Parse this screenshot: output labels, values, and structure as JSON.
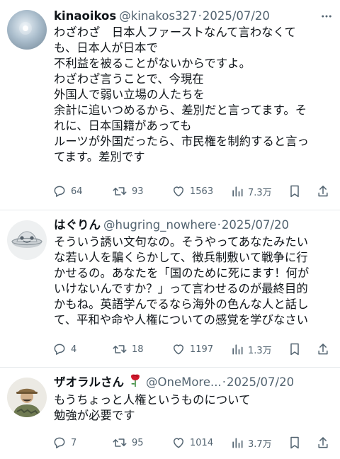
{
  "colors": {
    "text": "#0f1419",
    "muted": "#536471",
    "divider": "#e6e9ec"
  },
  "icons": [
    "more-icon",
    "reply-icon",
    "retweet-icon",
    "like-icon",
    "views-icon",
    "bookmark-icon",
    "share-icon",
    "rose-icon"
  ],
  "posts": [
    {
      "name": "kinaoikos",
      "handle": "@kinakos327",
      "dot": "·",
      "date": "2025/07/20",
      "lines": [
        "わざわざ　日本人ファーストなんて言わなくて",
        "も、日本人が日本で",
        "不利益を被ることがないからですよ。",
        "わざわざ言うことで、今現在",
        "外国人で弱い立場の人たちを",
        "余計に追いつめるから、差別だと言ってます。そ",
        "れに、日本国籍があっても",
        "ルーツが外国だったら、市民権を制約すると言っ",
        "てます。差別です"
      ],
      "replies": "64",
      "reposts": "93",
      "likes": "1563",
      "views": "7.3万"
    },
    {
      "name": "はぐりん",
      "handle": "@hugring_nowhere",
      "dot": "·",
      "date": "2025/07/20",
      "lines": [
        "そういう誘い文句なの。そうやってあなたみたい",
        "な若い人を騙くらかして、徴兵制敷いて戦争に行",
        "かせるの。あなたを「国のために死にます！何が",
        "いけないんですか？」って言わせるのが最終目的",
        "かもね。英語学んでるなら海外の色んな人と話し",
        "て、平和や命や人権についての感覚を学びなさい"
      ],
      "replies": "4",
      "reposts": "18",
      "likes": "1197",
      "views": "1.3万"
    },
    {
      "name": "ザオラルさん",
      "handle": "@OneMore...",
      "dot": "·",
      "date": "2025/07/20",
      "lines": [
        "もうちょっと人権というものについて",
        "勉強が必要です"
      ],
      "replies": "7",
      "reposts": "95",
      "likes": "1014",
      "views": "3.7万"
    }
  ]
}
